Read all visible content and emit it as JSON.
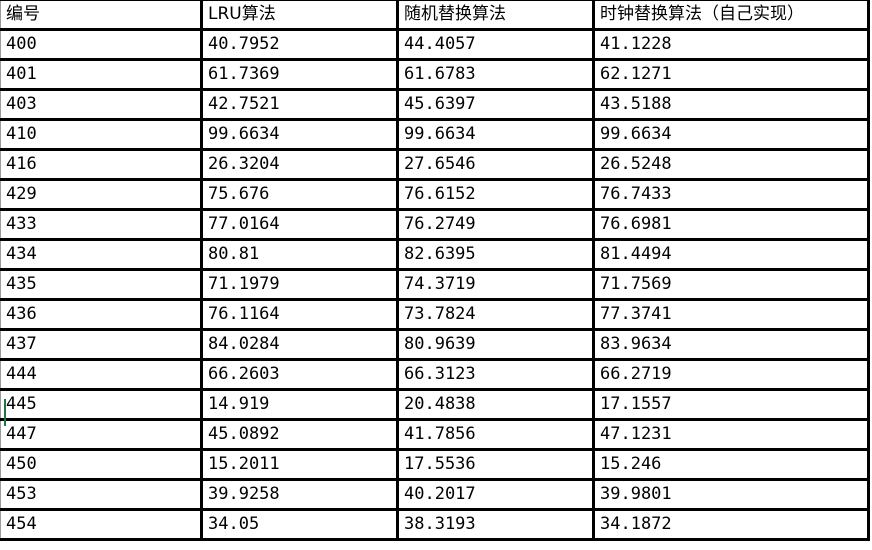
{
  "sheet": {
    "headers": [
      "编号",
      "LRU算法",
      "随机替换算法",
      "时钟替换算法（自己实现）"
    ],
    "rows": [
      [
        "400",
        "40.7952",
        "44.4057",
        "41.1228"
      ],
      [
        "401",
        "61.7369",
        "61.6783",
        "62.1271"
      ],
      [
        "403",
        "42.7521",
        "45.6397",
        "43.5188"
      ],
      [
        "410",
        "99.6634",
        "99.6634",
        "99.6634"
      ],
      [
        "416",
        "26.3204",
        "27.6546",
        "26.5248"
      ],
      [
        "429",
        "75.676",
        "76.6152",
        "76.7433"
      ],
      [
        "433",
        "77.0164",
        "76.2749",
        "76.6981"
      ],
      [
        "434",
        "80.81",
        "82.6395",
        "81.4494"
      ],
      [
        "435",
        "71.1979",
        "74.3719",
        "71.7569"
      ],
      [
        "436",
        "76.1164",
        "73.7824",
        "77.3741"
      ],
      [
        "437",
        "84.0284",
        "80.9639",
        "83.9634"
      ],
      [
        "444",
        "66.2603",
        "66.3123",
        "66.2719"
      ],
      [
        "445",
        "14.919",
        "20.4838",
        "17.1557"
      ],
      [
        "447",
        "45.0892",
        "41.7856",
        "47.1231"
      ],
      [
        "450",
        "15.2011",
        "17.5536",
        "15.246"
      ],
      [
        "453",
        "39.9258",
        "40.2017",
        "39.9801"
      ],
      [
        "454",
        "34.05",
        "38.3193",
        "34.1872"
      ]
    ]
  },
  "colors": {
    "grid": "#000000",
    "selection_marker": "#217346"
  }
}
